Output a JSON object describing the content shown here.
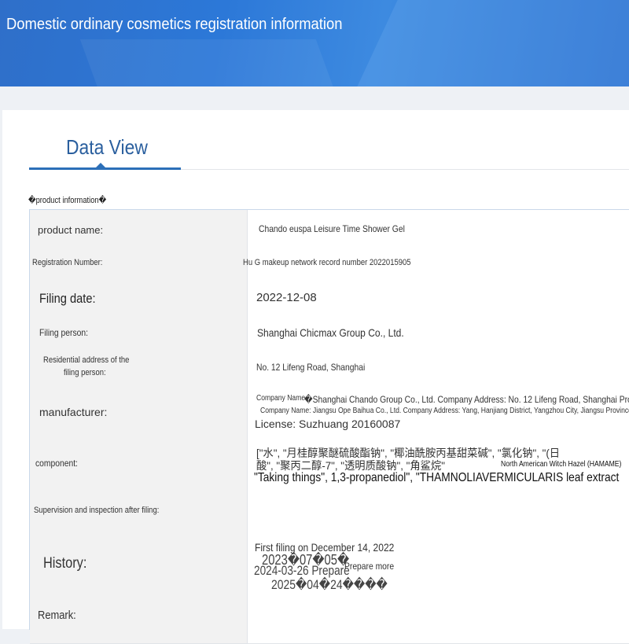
{
  "header": {
    "title": "Domestic ordinary cosmetics registration information"
  },
  "tabs": {
    "active_label": "Data View"
  },
  "section": {
    "heading": "�product information�"
  },
  "fields": {
    "product_name": {
      "label": "product name:",
      "value": "Chando euspa Leisure Time Shower Gel"
    },
    "registration_number": {
      "label": "Registration Number:",
      "value": "Hu G makeup network record number 2022015905"
    },
    "filing_date": {
      "label": "Filing date:",
      "value": "2022-12-08"
    },
    "filing_person": {
      "label": "Filing person:",
      "value": "Shanghai Chicmax Group Co., Ltd."
    },
    "residential_address": {
      "label_line1": "Residential address of the",
      "label_line2": "filing person:",
      "value": "No. 12 Lifeng Road, Shanghai"
    },
    "manufacturer": {
      "label": "manufacturer:",
      "line1_prefix": "Company Name",
      "line1_rest": "�Shanghai Chando Group Co., Ltd. Company Address: No. 12 Lifeng Road, Shanghai Prod",
      "line2": "Company Name: Jiangsu Ope Baihua Co., Ltd. Company Address: Yang, Hanjiang District, Yangzhou City, Jiangsu Province",
      "line3": "License: Suzhuang 20160087"
    },
    "component": {
      "label": "component:",
      "line1": "[\"水\", \"月桂醇聚醚硫酸酯钠\", \"椰油酰胺丙基甜菜碱\", \"氯化钠\", \"(日",
      "line2_cn": "酸\", \"聚丙二醇-7\", \"透明质酸钠\", \"角鲨烷\"",
      "line2_en": "North American Witch Hazel (HAMAME)",
      "line3": "\"Taking things\", 1,3-propanediol\", \"THAMNOLIAVERMICULARIS leaf extract"
    },
    "supervision": {
      "label": "Supervision and inspection after filing:",
      "value": ""
    },
    "history": {
      "label": "History:",
      "entries": [
        "First filing on December 14, 2022",
        "2023�07�05�",
        "2024-03-26 Prepare",
        "2025�04�24����"
      ],
      "more_link": "Prepare more"
    },
    "remark": {
      "label": "Remark:",
      "value": ""
    }
  }
}
